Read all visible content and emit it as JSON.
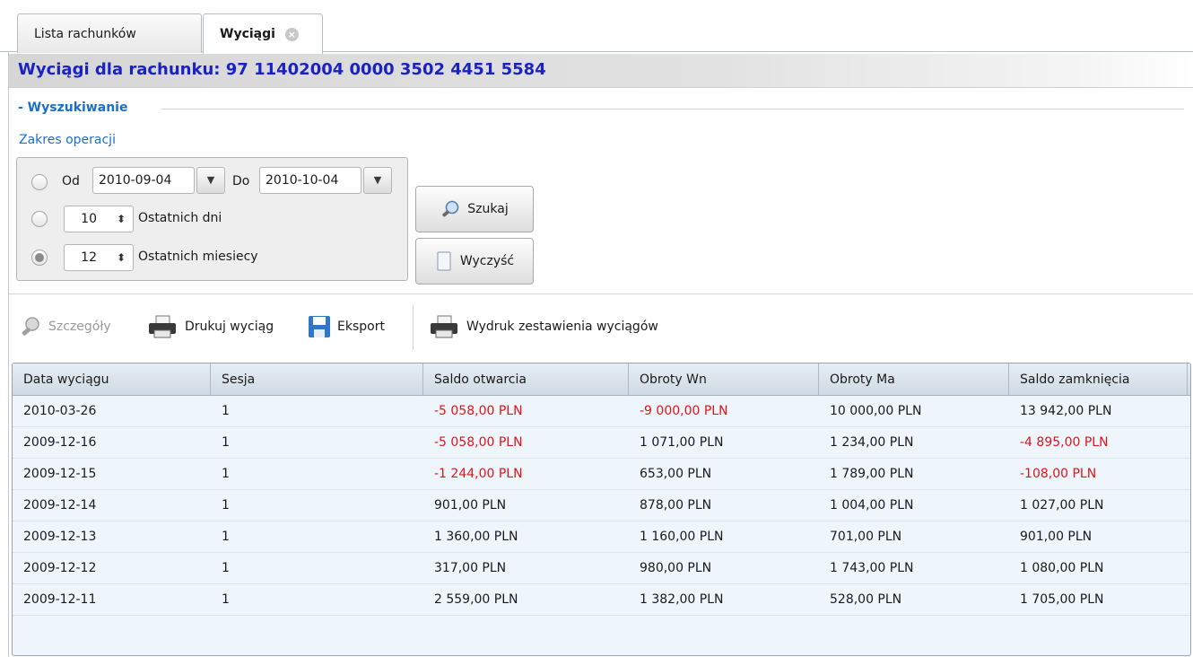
{
  "tabs": [
    {
      "label": "Lista rachunków"
    },
    {
      "label": "Wyciągi"
    }
  ],
  "header": {
    "title": "Wyciągi dla rachunku: 97 11402004 0000 3502 4451 5584"
  },
  "search": {
    "legend": "- Wyszukiwanie",
    "range_label": "Zakres operacji",
    "od_label": "Od",
    "od_value": "2010-09-04",
    "do_label": "Do",
    "do_value": "2010-10-04",
    "days_value": "10",
    "days_label": "Ostatnich dni",
    "months_value": "12",
    "months_label": "Ostatnich miesiecy",
    "selected": "months",
    "search_button": "Szukaj",
    "clear_button": "Wyczyść"
  },
  "toolbar": {
    "details": "Szczegóły",
    "print": "Drukuj wyciąg",
    "export": "Eksport",
    "summary_print": "Wydruk zestawienia wyciągów"
  },
  "table": {
    "columns": [
      "Data wyciągu",
      "Sesja",
      "Saldo otwarcia",
      "Obroty Wn",
      "Obroty Ma",
      "Saldo zamknięcia"
    ],
    "rows": [
      {
        "date": "2010-03-26",
        "session": "1",
        "open": "-5 058,00 PLN",
        "wn": "-9 000,00 PLN",
        "ma": "10 000,00 PLN",
        "close": "13 942,00 PLN"
      },
      {
        "date": "2009-12-16",
        "session": "1",
        "open": "-5 058,00 PLN",
        "wn": "1 071,00 PLN",
        "ma": "1 234,00 PLN",
        "close": "-4 895,00 PLN"
      },
      {
        "date": "2009-12-15",
        "session": "1",
        "open": "-1 244,00 PLN",
        "wn": "653,00 PLN",
        "ma": "1 789,00 PLN",
        "close": "-108,00 PLN"
      },
      {
        "date": "2009-12-14",
        "session": "1",
        "open": "901,00 PLN",
        "wn": "878,00 PLN",
        "ma": "1 004,00 PLN",
        "close": "1 027,00 PLN"
      },
      {
        "date": "2009-12-13",
        "session": "1",
        "open": "1 360,00 PLN",
        "wn": "1 160,00 PLN",
        "ma": "701,00 PLN",
        "close": "901,00 PLN"
      },
      {
        "date": "2009-12-12",
        "session": "1",
        "open": "317,00 PLN",
        "wn": "980,00 PLN",
        "ma": "1 743,00 PLN",
        "close": "1 080,00 PLN"
      },
      {
        "date": "2009-12-11",
        "session": "1",
        "open": "2 559,00 PLN",
        "wn": "1 382,00 PLN",
        "ma": "528,00 PLN",
        "close": "1 705,00 PLN"
      }
    ]
  },
  "colors": {
    "title": "#1a22c4",
    "accent": "#1a6fc8",
    "negative": "#e0141a"
  }
}
